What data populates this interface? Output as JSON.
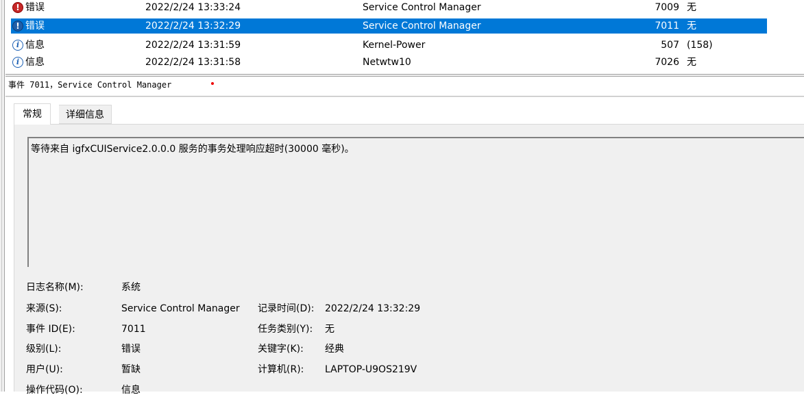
{
  "events": [
    {
      "level": "错误",
      "type": "error",
      "date": "2022/2/24 13:33:24",
      "source": "Service Control Manager",
      "event_id": "7009",
      "category": "无"
    },
    {
      "level": "错误",
      "type": "error",
      "date": "2022/2/24 13:32:29",
      "source": "Service Control Manager",
      "event_id": "7011",
      "category": "无",
      "selected": true
    },
    {
      "level": "信息",
      "type": "info",
      "date": "2022/2/24 13:31:59",
      "source": "Kernel-Power",
      "event_id": "507",
      "category": "(158)"
    },
    {
      "level": "信息",
      "type": "info",
      "date": "2022/2/24 13:31:58",
      "source": "Netwtw10",
      "event_id": "7026",
      "category": "无"
    }
  ],
  "detail": {
    "title": "事件 7011，Service Control Manager",
    "tabs": [
      "常规",
      "详细信息"
    ],
    "description": "等待来自 igfxCUIService2.0.0.0 服务的事务处理响应超时(30000 毫秒)。",
    "log_name_label": "日志名称(M):",
    "log_name": "系统",
    "source_label": "来源(S):",
    "source": "Service Control Manager",
    "logged_label": "记录时间(D):",
    "logged": "2022/2/24 13:32:29",
    "event_id_label": "事件 ID(E):",
    "event_id": "7011",
    "task_category_label": "任务类别(Y):",
    "task_category": "无",
    "level_label": "级别(L):",
    "level": "错误",
    "keywords_label": "关键字(K):",
    "keywords": "经典",
    "user_label": "用户(U):",
    "user": "暂缺",
    "computer_label": "计算机(R):",
    "computer": "LAPTOP-U9OS219V",
    "opcode_label": "操作代码(O):",
    "opcode": "信息"
  }
}
